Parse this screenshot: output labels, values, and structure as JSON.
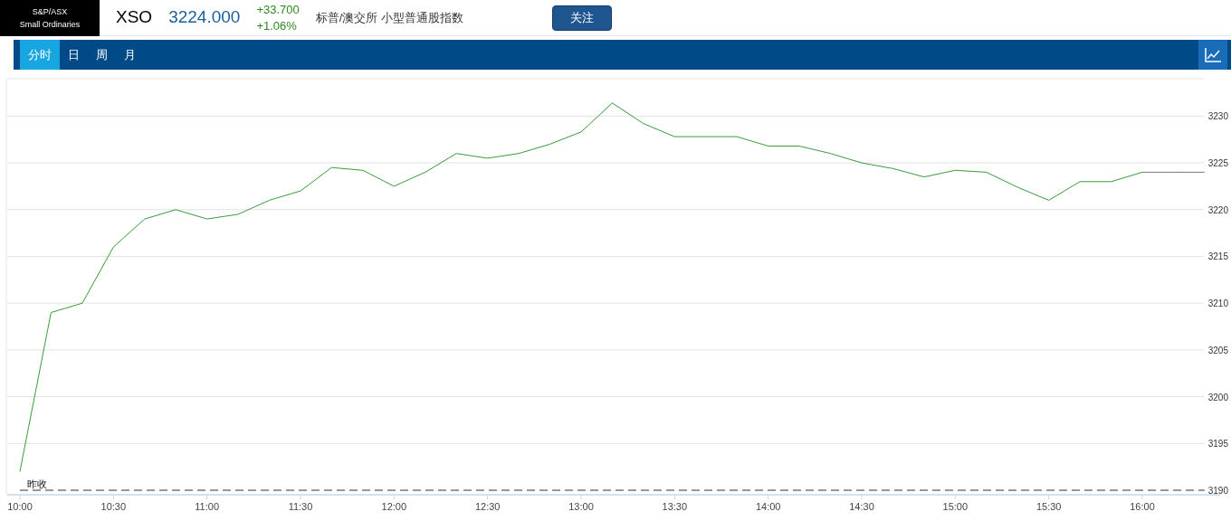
{
  "header": {
    "logo_lines": [
      "S&P/ASX",
      "Small Ordinaries"
    ],
    "symbol": "XSO",
    "price": "3224.000",
    "change": "+33.700",
    "change_percent": "+1.06%",
    "name": "标普/澳交所 小型普通股指数",
    "follow_button": "关注"
  },
  "tabs": [
    {
      "label": "分时",
      "selected": true
    },
    {
      "label": "日",
      "selected": false
    },
    {
      "label": "周",
      "selected": false
    },
    {
      "label": "月",
      "selected": false
    }
  ],
  "chart": {
    "chart_data": {
      "type": "line",
      "categories": [
        "10:00",
        null,
        null,
        "10:30",
        null,
        null,
        "11:00",
        null,
        null,
        "11:30",
        null,
        null,
        "12:00",
        null,
        null,
        "12:30",
        null,
        null,
        "13:00",
        null,
        null,
        "13:30",
        null,
        null,
        "14:00",
        null,
        null,
        "14:30",
        null,
        null,
        "15:00",
        null,
        null,
        "15:30",
        null,
        null,
        "16:00",
        null,
        null
      ],
      "series": [
        {
          "color": "#3a9a3a",
          "values": [
            3192,
            3209,
            3210,
            3216,
            3219,
            3220,
            3219,
            3219.5,
            3221,
            3222,
            3224.5,
            3224.2,
            3222.5,
            3224,
            3226,
            3225.5,
            3226,
            3227,
            3228.3,
            3231.4,
            3229.2,
            3227.8,
            3227.8,
            3227.8,
            3226.8,
            3226.8,
            3226,
            3225,
            3224.4,
            3223.5,
            3224.2,
            3224,
            3222.4,
            3221,
            3223,
            3223,
            3224,
            null,
            null
          ]
        },
        {
          "name": "昨收",
          "color": "#777777",
          "line_style": "dashed",
          "values": [
            3190,
            3190,
            3190,
            3190,
            3190,
            3190,
            3190,
            3190,
            3190,
            3190,
            3190,
            3190,
            3190,
            3190,
            3190,
            3190,
            3190,
            3190,
            3190,
            3190,
            3190,
            3190,
            3190,
            3190,
            3190,
            3190,
            3190,
            3190,
            3190,
            3190,
            3190,
            3190,
            3190,
            3190,
            3190,
            3190,
            3190,
            3190,
            3190
          ]
        },
        {
          "color": "#555555",
          "values": [
            null,
            null,
            null,
            null,
            null,
            null,
            null,
            null,
            null,
            null,
            null,
            null,
            null,
            null,
            null,
            null,
            null,
            null,
            null,
            null,
            null,
            null,
            null,
            null,
            null,
            null,
            null,
            null,
            null,
            null,
            null,
            null,
            null,
            null,
            null,
            null,
            3224,
            3224,
            3224
          ]
        }
      ],
      "grid": true,
      "ylim": [
        3190,
        3234
      ],
      "yticks": [
        3190,
        3195,
        3200,
        3205,
        3210,
        3215,
        3220,
        3225,
        3230
      ]
    }
  }
}
